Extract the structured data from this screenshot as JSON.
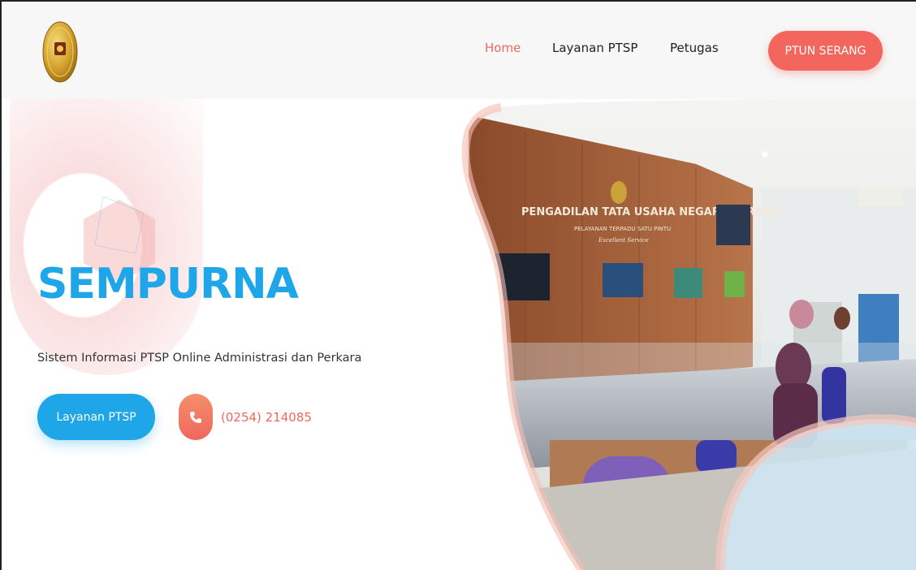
{
  "header": {
    "logo_icon": "court-emblem-icon",
    "nav": {
      "home": "Home",
      "layanan": "Layanan PTSP",
      "petugas": "Petugas"
    },
    "cta_label": "PTUN SERANG"
  },
  "hero": {
    "title": "SEMPURNA",
    "subtitle": "Sistem Informasi PTSP Online Administrasi dan Perkara",
    "button_label": "Layanan PTSP",
    "phone_icon": "phone-icon",
    "phone_number": "(0254) 214085"
  },
  "photo": {
    "sign_main": "PENGADILAN TATA USAHA NEGARA SERANG",
    "sign_sub": "PELAYANAN TERPADU SATU PINTU",
    "sign_tag": "Excellent Service"
  },
  "colors": {
    "accent_red": "#f2665e",
    "accent_blue": "#1ea6e8",
    "header_bg": "#f7f7f7"
  }
}
